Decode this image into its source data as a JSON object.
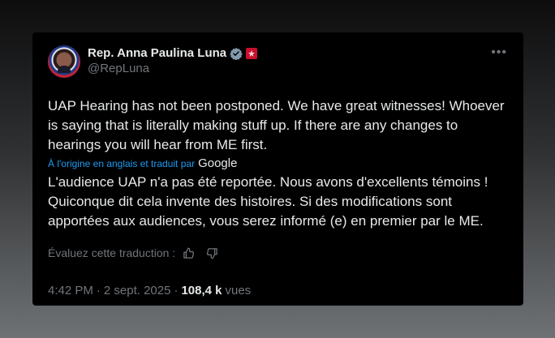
{
  "author": {
    "display_name": "Rep. Anna Paulina Luna",
    "handle": "@RepLuna"
  },
  "tweet": {
    "text": "UAP Hearing has not been postponed. We have great witnesses! Whoever is saying that is literally making stuff up. If there are any changes to hearings you will hear from ME first."
  },
  "translation": {
    "note": "À l'origine en anglais et traduit par",
    "provider": "Google",
    "text": "L'audience UAP n'a pas été reportée. Nous avons d'excellents témoins ! Quiconque dit cela invente des histoires. Si des modifications sont apportées aux audiences, vous serez informé (e) en premier par le ME.",
    "rate_label": "Évaluez cette traduction :"
  },
  "meta": {
    "time": "4:42 PM",
    "separator1": "·",
    "date": "2 sept. 2025",
    "separator2": "·",
    "views_count": "108,4 k",
    "views_label": "vues"
  },
  "icons": {
    "verified": "verified-badge-icon",
    "flag": "government-flag-icon",
    "more": "more-options-icon",
    "thumbs_up": "thumbs-up-icon",
    "thumbs_down": "thumbs-down-icon"
  },
  "colors": {
    "accent": "#1d9bf0",
    "muted": "#71767b",
    "text": "#e7e9ea",
    "background": "#000000"
  }
}
